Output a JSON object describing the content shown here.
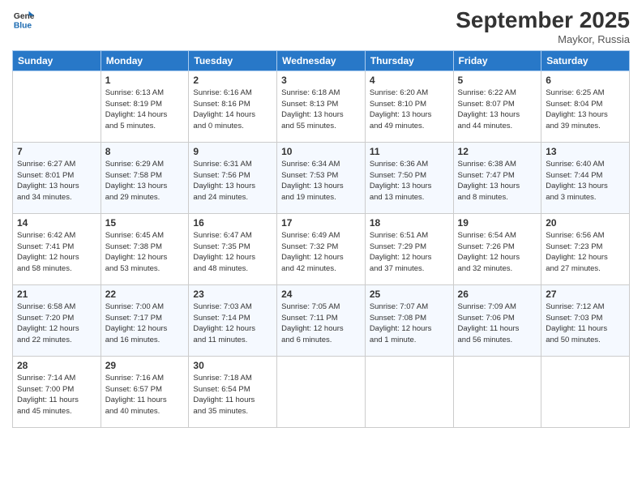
{
  "logo": {
    "line1": "General",
    "line2": "Blue"
  },
  "title": "September 2025",
  "subtitle": "Maykor, Russia",
  "headers": [
    "Sunday",
    "Monday",
    "Tuesday",
    "Wednesday",
    "Thursday",
    "Friday",
    "Saturday"
  ],
  "weeks": [
    [
      {
        "day": "",
        "info": ""
      },
      {
        "day": "1",
        "info": "Sunrise: 6:13 AM\nSunset: 8:19 PM\nDaylight: 14 hours\nand 5 minutes."
      },
      {
        "day": "2",
        "info": "Sunrise: 6:16 AM\nSunset: 8:16 PM\nDaylight: 14 hours\nand 0 minutes."
      },
      {
        "day": "3",
        "info": "Sunrise: 6:18 AM\nSunset: 8:13 PM\nDaylight: 13 hours\nand 55 minutes."
      },
      {
        "day": "4",
        "info": "Sunrise: 6:20 AM\nSunset: 8:10 PM\nDaylight: 13 hours\nand 49 minutes."
      },
      {
        "day": "5",
        "info": "Sunrise: 6:22 AM\nSunset: 8:07 PM\nDaylight: 13 hours\nand 44 minutes."
      },
      {
        "day": "6",
        "info": "Sunrise: 6:25 AM\nSunset: 8:04 PM\nDaylight: 13 hours\nand 39 minutes."
      }
    ],
    [
      {
        "day": "7",
        "info": "Sunrise: 6:27 AM\nSunset: 8:01 PM\nDaylight: 13 hours\nand 34 minutes."
      },
      {
        "day": "8",
        "info": "Sunrise: 6:29 AM\nSunset: 7:58 PM\nDaylight: 13 hours\nand 29 minutes."
      },
      {
        "day": "9",
        "info": "Sunrise: 6:31 AM\nSunset: 7:56 PM\nDaylight: 13 hours\nand 24 minutes."
      },
      {
        "day": "10",
        "info": "Sunrise: 6:34 AM\nSunset: 7:53 PM\nDaylight: 13 hours\nand 19 minutes."
      },
      {
        "day": "11",
        "info": "Sunrise: 6:36 AM\nSunset: 7:50 PM\nDaylight: 13 hours\nand 13 minutes."
      },
      {
        "day": "12",
        "info": "Sunrise: 6:38 AM\nSunset: 7:47 PM\nDaylight: 13 hours\nand 8 minutes."
      },
      {
        "day": "13",
        "info": "Sunrise: 6:40 AM\nSunset: 7:44 PM\nDaylight: 13 hours\nand 3 minutes."
      }
    ],
    [
      {
        "day": "14",
        "info": "Sunrise: 6:42 AM\nSunset: 7:41 PM\nDaylight: 12 hours\nand 58 minutes."
      },
      {
        "day": "15",
        "info": "Sunrise: 6:45 AM\nSunset: 7:38 PM\nDaylight: 12 hours\nand 53 minutes."
      },
      {
        "day": "16",
        "info": "Sunrise: 6:47 AM\nSunset: 7:35 PM\nDaylight: 12 hours\nand 48 minutes."
      },
      {
        "day": "17",
        "info": "Sunrise: 6:49 AM\nSunset: 7:32 PM\nDaylight: 12 hours\nand 42 minutes."
      },
      {
        "day": "18",
        "info": "Sunrise: 6:51 AM\nSunset: 7:29 PM\nDaylight: 12 hours\nand 37 minutes."
      },
      {
        "day": "19",
        "info": "Sunrise: 6:54 AM\nSunset: 7:26 PM\nDaylight: 12 hours\nand 32 minutes."
      },
      {
        "day": "20",
        "info": "Sunrise: 6:56 AM\nSunset: 7:23 PM\nDaylight: 12 hours\nand 27 minutes."
      }
    ],
    [
      {
        "day": "21",
        "info": "Sunrise: 6:58 AM\nSunset: 7:20 PM\nDaylight: 12 hours\nand 22 minutes."
      },
      {
        "day": "22",
        "info": "Sunrise: 7:00 AM\nSunset: 7:17 PM\nDaylight: 12 hours\nand 16 minutes."
      },
      {
        "day": "23",
        "info": "Sunrise: 7:03 AM\nSunset: 7:14 PM\nDaylight: 12 hours\nand 11 minutes."
      },
      {
        "day": "24",
        "info": "Sunrise: 7:05 AM\nSunset: 7:11 PM\nDaylight: 12 hours\nand 6 minutes."
      },
      {
        "day": "25",
        "info": "Sunrise: 7:07 AM\nSunset: 7:08 PM\nDaylight: 12 hours\nand 1 minute."
      },
      {
        "day": "26",
        "info": "Sunrise: 7:09 AM\nSunset: 7:06 PM\nDaylight: 11 hours\nand 56 minutes."
      },
      {
        "day": "27",
        "info": "Sunrise: 7:12 AM\nSunset: 7:03 PM\nDaylight: 11 hours\nand 50 minutes."
      }
    ],
    [
      {
        "day": "28",
        "info": "Sunrise: 7:14 AM\nSunset: 7:00 PM\nDaylight: 11 hours\nand 45 minutes."
      },
      {
        "day": "29",
        "info": "Sunrise: 7:16 AM\nSunset: 6:57 PM\nDaylight: 11 hours\nand 40 minutes."
      },
      {
        "day": "30",
        "info": "Sunrise: 7:18 AM\nSunset: 6:54 PM\nDaylight: 11 hours\nand 35 minutes."
      },
      {
        "day": "",
        "info": ""
      },
      {
        "day": "",
        "info": ""
      },
      {
        "day": "",
        "info": ""
      },
      {
        "day": "",
        "info": ""
      }
    ]
  ]
}
